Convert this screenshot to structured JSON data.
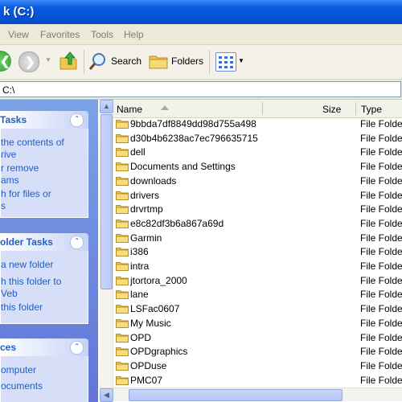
{
  "window": {
    "title": "k (C:)"
  },
  "menu": [
    "View",
    "Favorites",
    "Tools",
    "Help"
  ],
  "toolbar": {
    "search_label": "Search",
    "folders_label": "Folders"
  },
  "address": {
    "value": "C:\\"
  },
  "tasks": {
    "system": {
      "title": "Tasks",
      "lines": [
        "the contents of",
        "rive",
        "r remove",
        "ams",
        "h for files or",
        "s"
      ]
    },
    "folder": {
      "title": "older Tasks",
      "lines": [
        "a new folder",
        "h this folder to",
        "Veb",
        " this folder"
      ]
    },
    "places": {
      "title": "ces",
      "lines": [
        "omputer",
        "ocuments"
      ]
    }
  },
  "list": {
    "headers": {
      "name": "Name",
      "size": "Size",
      "type": "Type"
    },
    "rows": [
      {
        "name": "9bbda7df8849dd98d755a498",
        "type": "File Folder"
      },
      {
        "name": "d30b4b6238ac7ec796635715",
        "type": "File Folder"
      },
      {
        "name": "dell",
        "type": "File Folder"
      },
      {
        "name": "Documents and Settings",
        "type": "File Folder"
      },
      {
        "name": "downloads",
        "type": "File Folder"
      },
      {
        "name": "drivers",
        "type": "File Folder"
      },
      {
        "name": "drvrtmp",
        "type": "File Folder"
      },
      {
        "name": "e8c82df3b6a867a69d",
        "type": "File Folder"
      },
      {
        "name": "Garmin",
        "type": "File Folder"
      },
      {
        "name": "i386",
        "type": "File Folder"
      },
      {
        "name": "intra",
        "type": "File Folder"
      },
      {
        "name": "jtortora_2000",
        "type": "File Folder"
      },
      {
        "name": "lane",
        "type": "File Folder"
      },
      {
        "name": "LSFac0607",
        "type": "File Folder"
      },
      {
        "name": "My Music",
        "type": "File Folder"
      },
      {
        "name": "OPD",
        "type": "File Folder"
      },
      {
        "name": "OPDgraphics",
        "type": "File Folder"
      },
      {
        "name": "OPDuse",
        "type": "File Folder"
      },
      {
        "name": "PMC07",
        "type": "File Folder"
      }
    ]
  },
  "icons": [
    "back-icon",
    "forward-icon",
    "up-folder-icon",
    "search-icon",
    "folders-icon",
    "views-icon",
    "folder-icon",
    "collapse-icon"
  ]
}
